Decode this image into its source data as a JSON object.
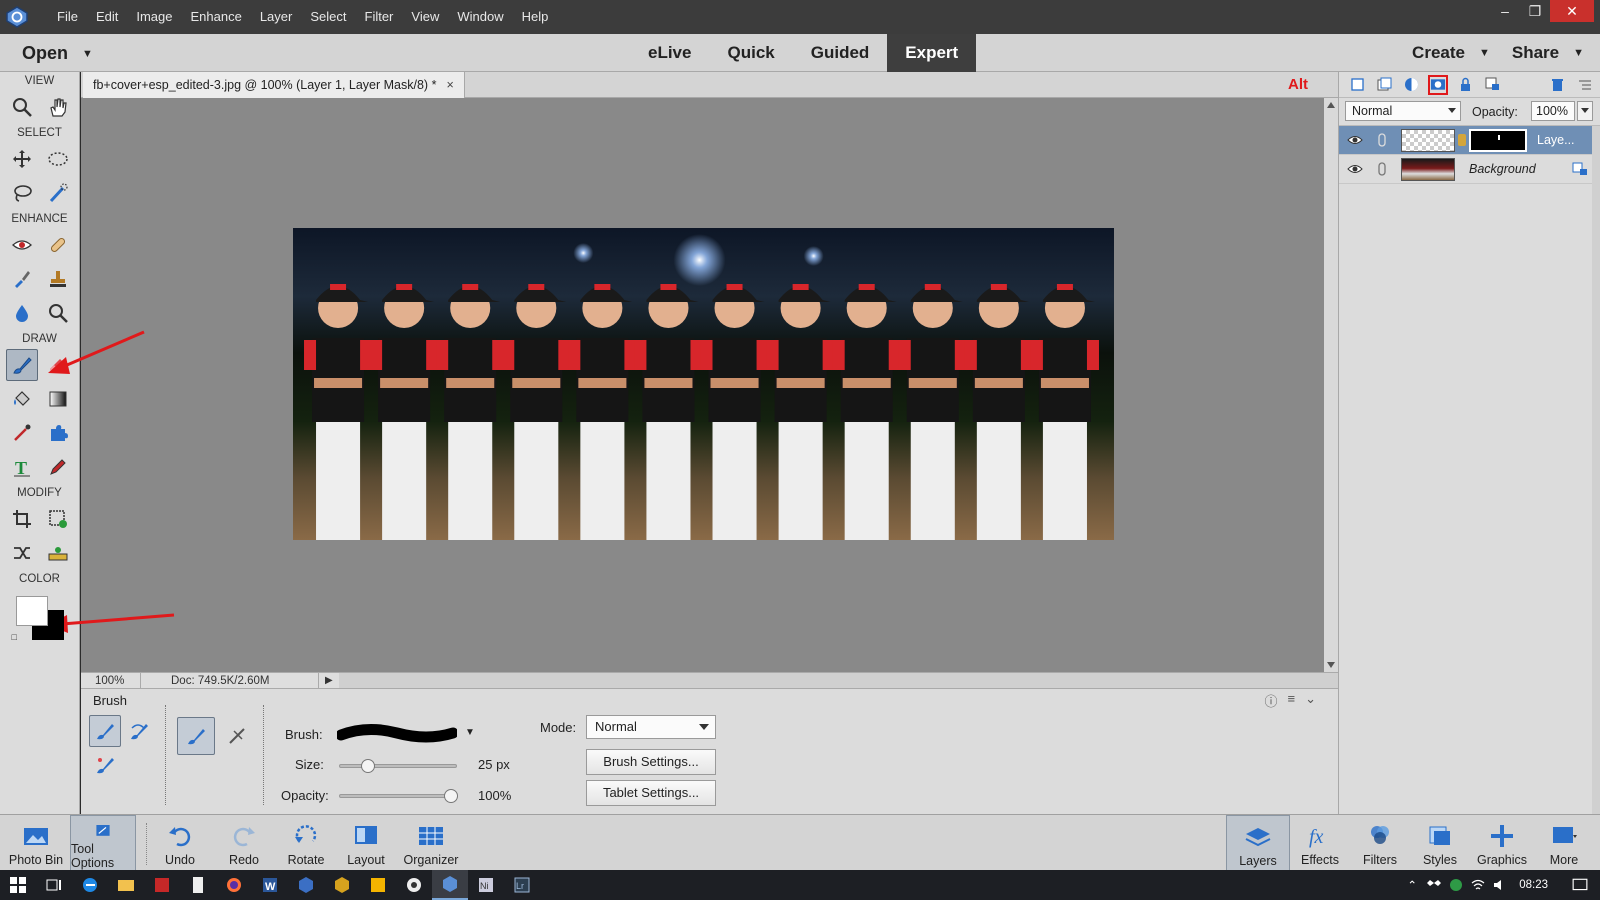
{
  "menubar": {
    "items": [
      "File",
      "Edit",
      "Image",
      "Enhance",
      "Layer",
      "Select",
      "Filter",
      "View",
      "Window",
      "Help"
    ]
  },
  "modebar": {
    "open_label": "Open",
    "tabs": [
      "eLive",
      "Quick",
      "Guided",
      "Expert"
    ],
    "active_tab": "Expert",
    "create_label": "Create",
    "share_label": "Share"
  },
  "toolpanel": {
    "sections": [
      "VIEW",
      "SELECT",
      "ENHANCE",
      "DRAW",
      "MODIFY",
      "COLOR"
    ],
    "foreground_color": "#ffffff",
    "background_color": "#000000"
  },
  "document": {
    "tab_title": "fb+cover+esp_edited-3.jpg @ 100% (Layer 1, Layer Mask/8) *",
    "alt_indicator": "Alt",
    "zoom": "100%",
    "doc_info": "Doc: 749.5K/2.60M"
  },
  "tooloptions": {
    "title": "Brush",
    "brush_label": "Brush:",
    "size_label": "Size:",
    "size_value": "25 px",
    "size_fraction": 0.2,
    "opacity_label": "Opacity:",
    "opacity_value": "100%",
    "opacity_fraction": 1.0,
    "mode_label": "Mode:",
    "mode_value": "Normal",
    "brush_settings_label": "Brush Settings...",
    "tablet_settings_label": "Tablet Settings..."
  },
  "layers": {
    "blend_mode": "Normal",
    "opacity_label": "Opacity:",
    "opacity_value": "100%",
    "items": [
      {
        "name": "Laye...",
        "active": true
      },
      {
        "name": "Background",
        "active": false
      }
    ]
  },
  "bottombar": {
    "left": [
      "Photo Bin",
      "Tool Options",
      "Undo",
      "Redo",
      "Rotate",
      "Layout",
      "Organizer"
    ],
    "right": [
      "Layers",
      "Effects",
      "Filters",
      "Styles",
      "Graphics",
      "More"
    ]
  },
  "taskbar": {
    "clock": "08:23"
  },
  "colors": {
    "accent_red": "#e0191b",
    "active_layer": "#6f8fb5",
    "mode_tab_active": "#3e3e3e"
  }
}
